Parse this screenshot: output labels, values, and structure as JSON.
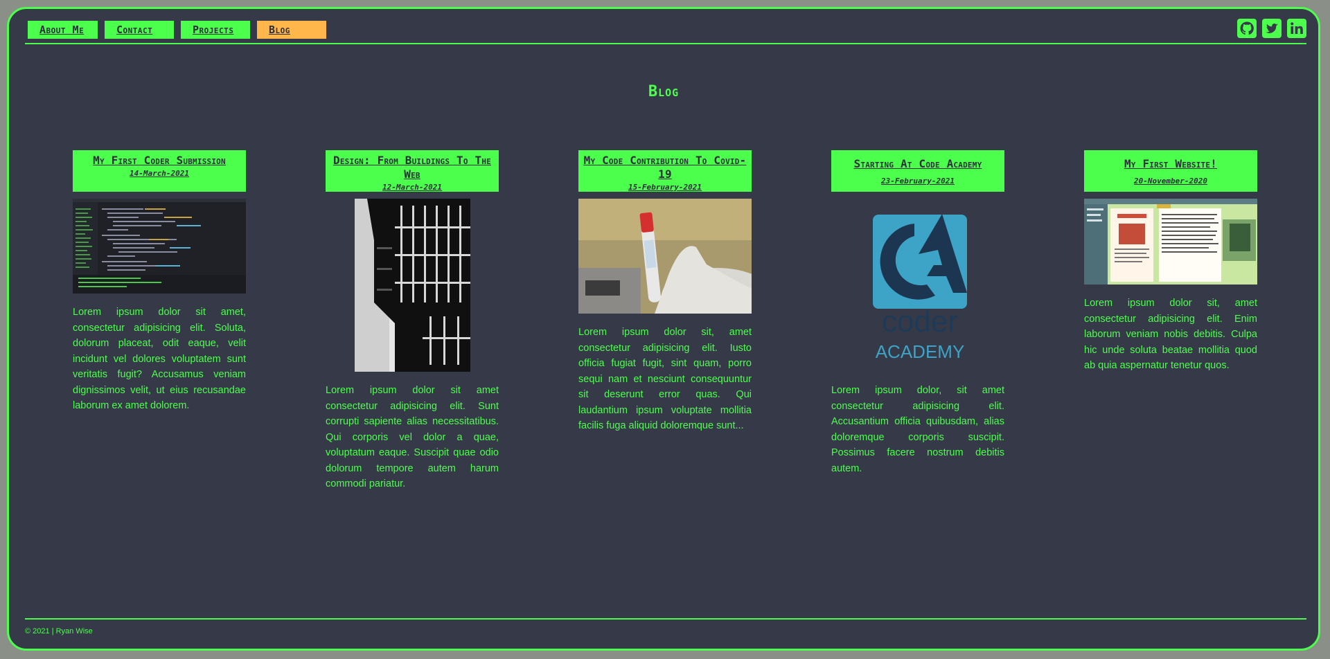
{
  "nav": {
    "items": [
      {
        "label": "About Me"
      },
      {
        "label": "Contact"
      },
      {
        "label": "Projects"
      },
      {
        "label": "Blog",
        "active": true
      }
    ]
  },
  "social": [
    "github-icon",
    "twitter-icon",
    "linkedin-icon"
  ],
  "page": {
    "title": "Blog"
  },
  "posts": [
    {
      "title": "My First Coder Submission",
      "date": "14-March-2021",
      "image": "code-editor-screenshot",
      "text": "Lorem ipsum dolor sit amet, consectetur adipisicing elit. Soluta, dolorum placeat, odit eaque, velit incidunt vel dolores voluptatem sunt veritatis fugit? Accusamus veniam dignissimos velit, ut eius recusandae laborum ex amet dolorem."
    },
    {
      "title": "Design: From Buildings To The Web",
      "date": "12-March-2021",
      "image": "building-photo",
      "text": "Lorem ipsum dolor sit amet consectetur adipisicing elit. Sunt corrupti sapiente alias necessitatibus. Qui corporis vel dolor a quae, voluptatum eaque. Suscipit quae odio dolorum tempore autem harum commodi pariatur."
    },
    {
      "title": "My Code Contribution To Covid-19",
      "date": "15-February-2021",
      "image": "test-tube-photo",
      "text": "Lorem ipsum dolor sit, amet consectetur adipisicing elit. Iusto officia fugiat fugit, sint quam, porro sequi nam et nesciunt consequuntur sit deserunt error quas. Qui laudantium ipsum voluptate mollitia facilis fuga aliquid doloremque sunt..."
    },
    {
      "title": "Starting At Code Academy",
      "date": "23-February-2021",
      "image": "coder-academy-logo",
      "logo_word1": "coder",
      "logo_word2": "ACADEMY",
      "text": "Lorem ipsum dolor, sit amet consectetur adipisicing elit. Accusantium officia quibusdam, alias doloremque corporis suscipit. Possimus facere nostrum debitis autem."
    },
    {
      "title": "My First Website!",
      "date": "20-November-2020",
      "image": "website-screenshot",
      "text": "Lorem ipsum dolor sit, amet consectetur adipisicing elit. Enim laborum veniam nobis debitis. Culpa hic unde soluta beatae mollitia quod ab quia aspernatur tenetur quos."
    }
  ],
  "footer": {
    "text": "© 2021 | Ryan Wise"
  },
  "colors": {
    "accent": "#4cff4c",
    "active": "#ffb64a",
    "background": "#363a48"
  }
}
